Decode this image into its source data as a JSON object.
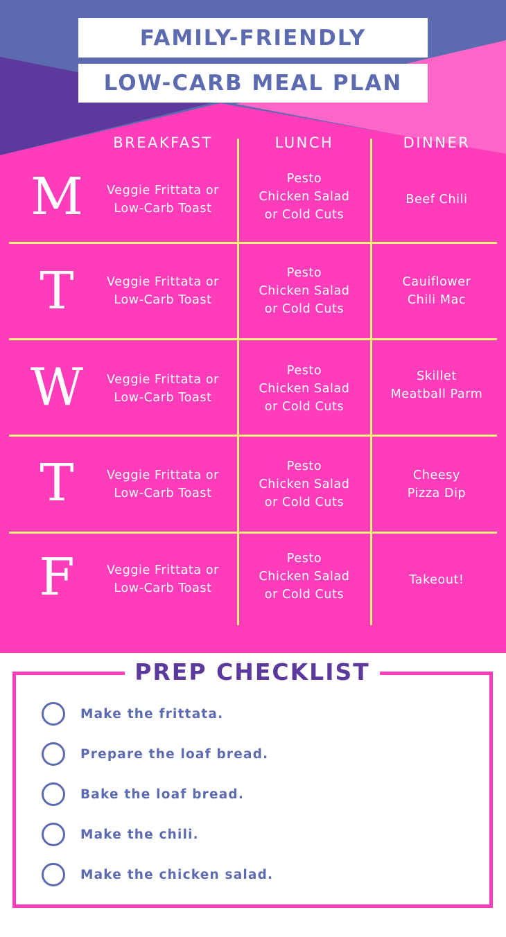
{
  "title": {
    "line1": "FAMILY-FRIENDLY",
    "line2": "LOW-CARB MEAL PLAN"
  },
  "colors": {
    "slate_blue": "#5c6aaf",
    "purple": "#5c3a9d",
    "hot_pink": "#ff3cb9",
    "light_pink": "#ff66c8",
    "grid_yellow": "#fff27a",
    "white": "#ffffff"
  },
  "meal_plan": {
    "columns": [
      "BREAKFAST",
      "LUNCH",
      "DINNER"
    ],
    "rows": [
      {
        "day": "M",
        "breakfast": "Veggie Frittata or\nLow-Carb Toast",
        "lunch": "Pesto\nChicken Salad\nor Cold Cuts",
        "dinner": "Beef Chili"
      },
      {
        "day": "T",
        "breakfast": "Veggie Frittata or\nLow-Carb Toast",
        "lunch": "Pesto\nChicken Salad\nor Cold Cuts",
        "dinner": "Cauiflower\nChili Mac"
      },
      {
        "day": "W",
        "breakfast": "Veggie Frittata or\nLow-Carb Toast",
        "lunch": "Pesto\nChicken Salad\nor Cold Cuts",
        "dinner": "Skillet\nMeatball Parm"
      },
      {
        "day": "T",
        "breakfast": "Veggie Frittata or\nLow-Carb Toast",
        "lunch": "Pesto\nChicken Salad\nor Cold Cuts",
        "dinner": "Cheesy\nPizza Dip"
      },
      {
        "day": "F",
        "breakfast": "Veggie Frittata or\nLow-Carb Toast",
        "lunch": "Pesto\nChicken Salad\nor Cold Cuts",
        "dinner": "Takeout!"
      }
    ]
  },
  "checklist": {
    "title": "PREP CHECKLIST",
    "items": [
      {
        "label": "Make the frittata.",
        "checked": false
      },
      {
        "label": "Prepare the loaf bread.",
        "checked": false
      },
      {
        "label": "Bake the loaf bread.",
        "checked": false
      },
      {
        "label": "Make the chili.",
        "checked": false
      },
      {
        "label": "Make the chicken salad.",
        "checked": false
      }
    ]
  }
}
